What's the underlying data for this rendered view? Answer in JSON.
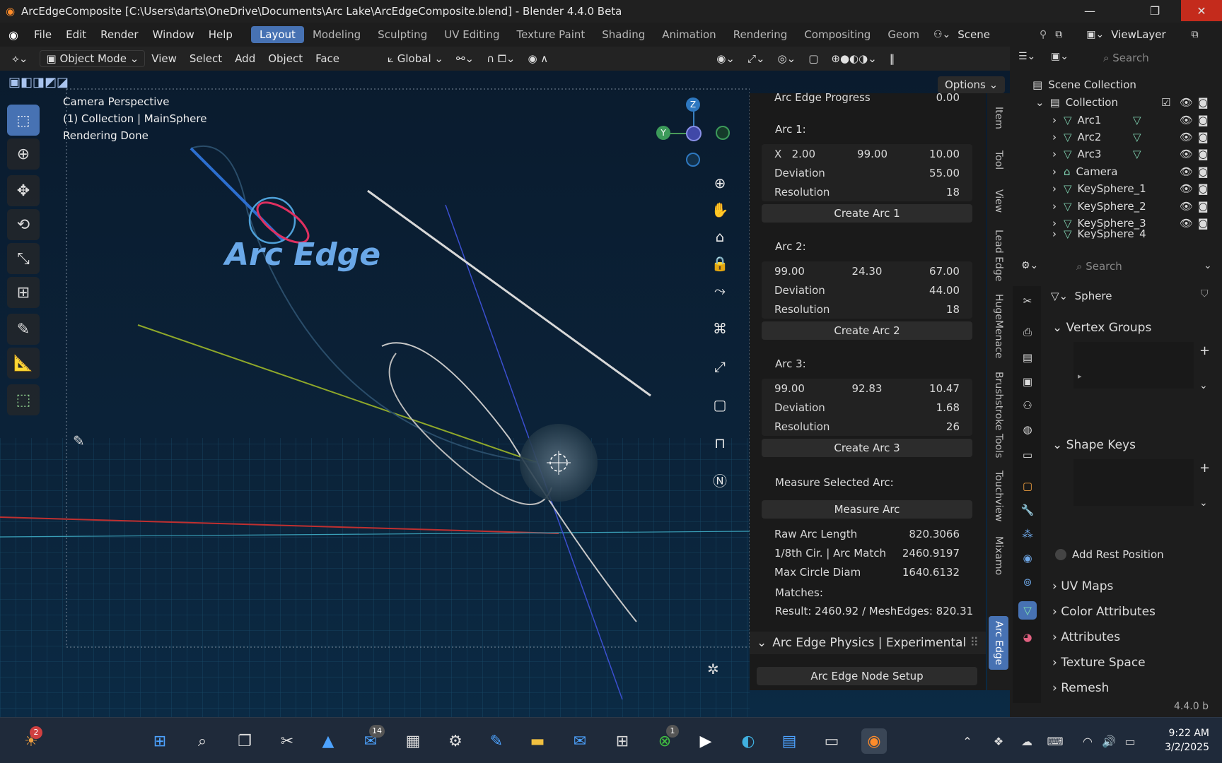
{
  "window": {
    "title": "ArcEdgeComposite [C:\\Users\\darts\\OneDrive\\Documents\\Arc Lake\\ArcEdgeComposite.blend] - Blender 4.4.0 Beta"
  },
  "menu": [
    "File",
    "Edit",
    "Render",
    "Window",
    "Help"
  ],
  "workspaces": [
    "Layout",
    "Modeling",
    "Sculpting",
    "UV Editing",
    "Texture Paint",
    "Shading",
    "Animation",
    "Rendering",
    "Compositing",
    "Geom"
  ],
  "scene": "Scene",
  "viewlayer": "ViewLayer",
  "header": {
    "mode": "Object Mode",
    "menus": [
      "View",
      "Select",
      "Add",
      "Object",
      "Face"
    ],
    "transform": "Global",
    "options": "Options"
  },
  "viewport": {
    "line1": "Camera Perspective",
    "line2": "(1) Collection | MainSphere",
    "line3": "Rendering Done",
    "logo": "Arc Edge"
  },
  "gizmo": {
    "z": "Z",
    "y": "Y"
  },
  "npanel": {
    "progress_label": "Arc Edge Progress",
    "progress_value": "0.00",
    "arc1": {
      "title": "Arc 1:",
      "x_label": "X",
      "v1": "2.00",
      "v2": "99.00",
      "v3": "10.00",
      "dev_label": "Deviation",
      "dev": "55.00",
      "res_label": "Resolution",
      "res": "18",
      "button": "Create Arc 1"
    },
    "arc2": {
      "title": "Arc 2:",
      "v1": "99.00",
      "v2": "24.30",
      "v3": "67.00",
      "dev_label": "Deviation",
      "dev": "44.00",
      "res_label": "Resolution",
      "res": "18",
      "button": "Create Arc 2"
    },
    "arc3": {
      "title": "Arc 3:",
      "v1": "99.00",
      "v2": "92.83",
      "v3": "10.47",
      "dev_label": "Deviation",
      "dev": "1.68",
      "res_label": "Resolution",
      "res": "26",
      "button": "Create Arc 3"
    },
    "measure_title": "Measure Selected Arc:",
    "measure_button": "Measure Arc",
    "raw_label": "Raw Arc Length",
    "raw": "820.3066",
    "cir_label": "1/8th Cir. | Arc Match",
    "cir": "2460.9197",
    "diam_label": "Max Circle Diam",
    "diam": "1640.6132",
    "matches": "Matches:",
    "result": "Result: 2460.92 / MeshEdges: 820.31",
    "physics": "Arc Edge Physics | Experimental",
    "node_button": "Arc Edge Node Setup"
  },
  "vtabs": [
    "Item",
    "Tool",
    "View",
    "Lead Edge",
    "HugeMenace",
    "Brushstroke Tools",
    "Touchview",
    "Mixamo",
    "Arc Edge"
  ],
  "outliner": {
    "search": "Search",
    "scene_collection": "Scene Collection",
    "collection": "Collection",
    "items": [
      "Arc1",
      "Arc2",
      "Arc3",
      "Camera",
      "KeySphere_1",
      "KeySphere_2",
      "KeySphere_3",
      "KeySphere_4"
    ]
  },
  "props": {
    "search": "Search",
    "object": "Sphere",
    "sections": [
      "Vertex Groups",
      "Shape Keys"
    ],
    "add_rest": "Add Rest Position",
    "collapsed": [
      "UV Maps",
      "Color Attributes",
      "Attributes",
      "Texture Space",
      "Remesh"
    ]
  },
  "version": "4.4.0 b",
  "taskbar": {
    "time": "9:22 AM",
    "date": "3/2/2025",
    "badge_weather": "2",
    "badge_store": "14",
    "badge_xbox": "1"
  },
  "colors": {
    "accent": "#4772b3",
    "bg": "#1d1d1d"
  }
}
